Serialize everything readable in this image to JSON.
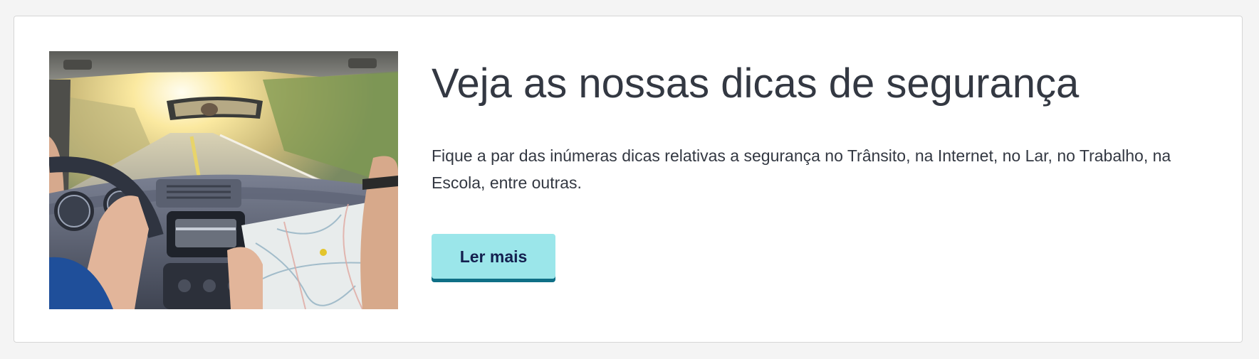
{
  "promo": {
    "image_alt": "car-interior-photo",
    "title": "Veja as nossas dicas de segurança",
    "description": "Fique a par das inúmeras dicas relativas a segurança no Trânsito, na Internet, no Lar, no Trabalho, na Escola, entre outras.",
    "button_label": "Ler mais"
  },
  "colors": {
    "page_background": "#f4f4f4",
    "card_background": "#ffffff",
    "text": "#333842",
    "button_background": "#9be6ea",
    "button_border": "#0f6f86",
    "button_text": "#14204f"
  }
}
